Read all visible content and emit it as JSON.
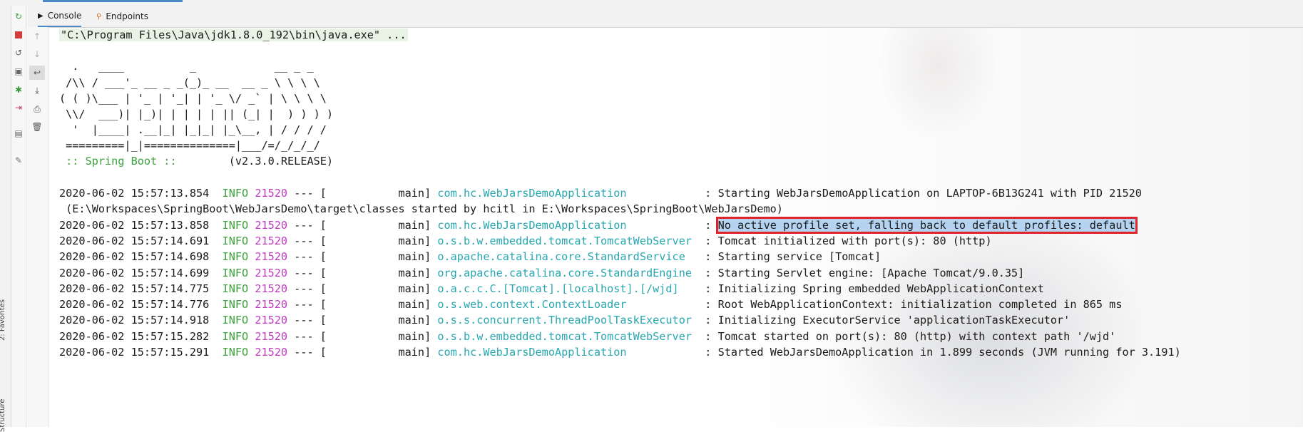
{
  "tabs": {
    "console": "Console",
    "endpoints": "Endpoints"
  },
  "side_labels": {
    "favorites": "2: Favorites",
    "structure": "Structure"
  },
  "command_line": "\"C:\\Program Files\\Java\\jdk1.8.0_192\\bin\\java.exe\" ...",
  "banner": [
    "  .   ____          _            __ _ _",
    " /\\\\ / ___'_ __ _ _(_)_ __  __ _ \\ \\ \\ \\",
    "( ( )\\___ | '_ | '_| | '_ \\/ _` | \\ \\ \\ \\",
    " \\\\/  ___)| |_)| | | | | || (_| |  ) ) ) )",
    "  '  |____| .__|_| |_|_| |_\\__, | / / / /",
    " =========|_|==============|___/=/_/_/_/"
  ],
  "spring_boot_label": " :: Spring Boot :: ",
  "spring_boot_version": "       (v2.3.0.RELEASE)",
  "log_lines": [
    {
      "ts": "2020-06-02 15:57:13.854",
      "level": "INFO",
      "pid": "21520",
      "sep": " --- [           main] ",
      "logger": "com.hc.WebJarsDemoApplication           ",
      "colon": " : ",
      "msg": "Starting WebJarsDemoApplication on LAPTOP-6B13G241 with PID 21520"
    },
    {
      "continuation": " (E:\\Workspaces\\SpringBoot\\WebJarsDemo\\target\\classes started by hcitl in E:\\Workspaces\\SpringBoot\\WebJarsDemo)"
    },
    {
      "ts": "2020-06-02 15:57:13.858",
      "level": "INFO",
      "pid": "21520",
      "sep": " --- [           main] ",
      "logger": "com.hc.WebJarsDemoApplication           ",
      "colon": " : ",
      "msg": "No active profile set, falling back to default profiles: default",
      "highlight": true
    },
    {
      "ts": "2020-06-02 15:57:14.691",
      "level": "INFO",
      "pid": "21520",
      "sep": " --- [           main] ",
      "logger": "o.s.b.w.embedded.tomcat.TomcatWebServer ",
      "colon": " : ",
      "msg": "Tomcat initialized with port(s): 80 (http)"
    },
    {
      "ts": "2020-06-02 15:57:14.698",
      "level": "INFO",
      "pid": "21520",
      "sep": " --- [           main] ",
      "logger": "o.apache.catalina.core.StandardService  ",
      "colon": " : ",
      "msg": "Starting service [Tomcat]"
    },
    {
      "ts": "2020-06-02 15:57:14.699",
      "level": "INFO",
      "pid": "21520",
      "sep": " --- [           main] ",
      "logger": "org.apache.catalina.core.StandardEngine ",
      "colon": " : ",
      "msg": "Starting Servlet engine: [Apache Tomcat/9.0.35]"
    },
    {
      "ts": "2020-06-02 15:57:14.775",
      "level": "INFO",
      "pid": "21520",
      "sep": " --- [           main] ",
      "logger": "o.a.c.c.C.[Tomcat].[localhost].[/wjd]   ",
      "colon": " : ",
      "msg": "Initializing Spring embedded WebApplicationContext"
    },
    {
      "ts": "2020-06-02 15:57:14.776",
      "level": "INFO",
      "pid": "21520",
      "sep": " --- [           main] ",
      "logger": "o.s.web.context.ContextLoader           ",
      "colon": " : ",
      "msg": "Root WebApplicationContext: initialization completed in 865 ms"
    },
    {
      "ts": "2020-06-02 15:57:14.918",
      "level": "INFO",
      "pid": "21520",
      "sep": " --- [           main] ",
      "logger": "o.s.s.concurrent.ThreadPoolTaskExecutor ",
      "colon": " : ",
      "msg": "Initializing ExecutorService 'applicationTaskExecutor'"
    },
    {
      "ts": "2020-06-02 15:57:15.282",
      "level": "INFO",
      "pid": "21520",
      "sep": " --- [           main] ",
      "logger": "o.s.b.w.embedded.tomcat.TomcatWebServer ",
      "colon": " : ",
      "msg": "Tomcat started on port(s): 80 (http) with context path '/wjd'"
    },
    {
      "ts": "2020-06-02 15:57:15.291",
      "level": "INFO",
      "pid": "21520",
      "sep": " --- [           main] ",
      "logger": "com.hc.WebJarsDemoApplication           ",
      "colon": " : ",
      "msg": "Started WebJarsDemoApplication in 1.899 seconds (JVM running for 3.191)"
    }
  ],
  "colors": {
    "info": "#3ca23c",
    "pid": "#c23ac2",
    "logger": "#27a7b0",
    "highlight_border": "#e0242b",
    "highlight_bg": "#b4d3f1"
  },
  "icons": {
    "left_toolbar": [
      "rerun-icon",
      "stop-icon",
      "restore-layout-icon",
      "camera-icon",
      "debug-icon",
      "exit-icon",
      "layout-icon",
      "pin-icon"
    ],
    "console_toolbar": [
      "scroll-up-icon",
      "scroll-down-icon",
      "soft-wrap-icon",
      "scroll-to-end-icon",
      "print-icon",
      "clear-icon"
    ]
  }
}
